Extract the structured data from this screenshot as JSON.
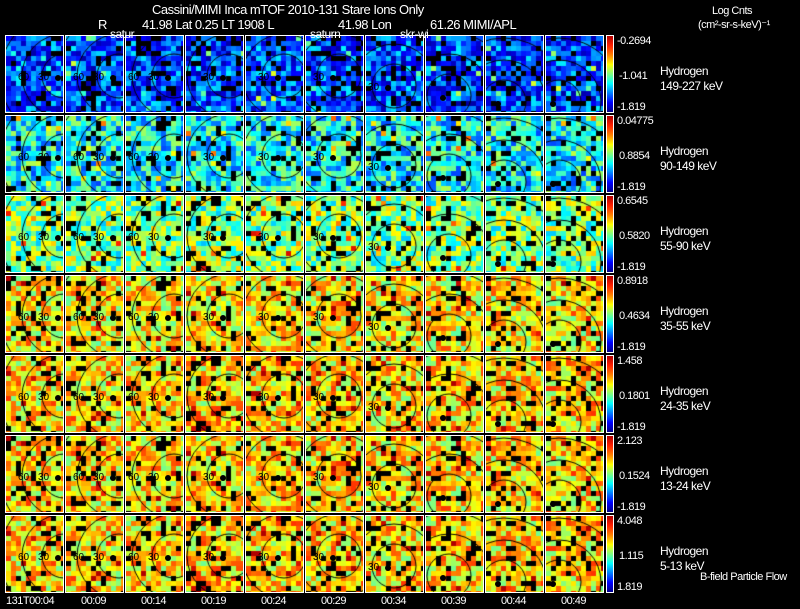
{
  "header": {
    "title": "Cassini/MIMI Inca mTOF  2010-131    Stare    Ions Only",
    "r_label": "R",
    "position_1": "41.98 Lat 0.25 LT 1908 L",
    "position_2": "41.98 Lon",
    "position_3": "61.26  MIMI/APL",
    "units_line1": "Log Cnts",
    "units_line2": "(cm²-sr-s-keV)⁻¹",
    "overlay_labels": [
      "satur",
      "saturn",
      "skr-wi"
    ]
  },
  "footer_note": "B-field Particle Flow",
  "chart_data": {
    "type": "heatmap",
    "colormap": "rainbow (dark blue low → red high)",
    "missing_color": "#000000",
    "time_labels": [
      "131T00:04",
      "00:09",
      "00:14",
      "00:19",
      "00:24",
      "00:29",
      "00:34",
      "00:39",
      "00:44",
      "00:49"
    ],
    "contour_levels": [
      "30",
      "60",
      "90",
      "120",
      "150"
    ],
    "rows": [
      {
        "species": "Hydrogen",
        "energy": "149-227 keV",
        "cbar_max": "-0.2694",
        "cbar_mid": "-1.041",
        "cbar_min": "-1.819"
      },
      {
        "species": "Hydrogen",
        "energy": "90-149 keV",
        "cbar_max": "0.04775",
        "cbar_mid": "0.8854",
        "cbar_min": "-1.819"
      },
      {
        "species": "Hydrogen",
        "energy": "55-90 keV",
        "cbar_max": "0.6545",
        "cbar_mid": "0.5820",
        "cbar_min": "-1.819"
      },
      {
        "species": "Hydrogen",
        "energy": "35-55 keV",
        "cbar_max": "0.8918",
        "cbar_mid": "0.4634",
        "cbar_min": "-1.819"
      },
      {
        "species": "Hydrogen",
        "energy": "24-35 keV",
        "cbar_max": "1.458",
        "cbar_mid": "0.1801",
        "cbar_min": "-1.819"
      },
      {
        "species": "Hydrogen",
        "energy": "13-24 keV",
        "cbar_max": "2.123",
        "cbar_mid": "0.1524",
        "cbar_min": "-1.819"
      },
      {
        "species": "Hydrogen",
        "energy": "5-13 keV",
        "cbar_max": "4.048",
        "cbar_mid": "1.115",
        "cbar_min": "1.819"
      }
    ]
  }
}
